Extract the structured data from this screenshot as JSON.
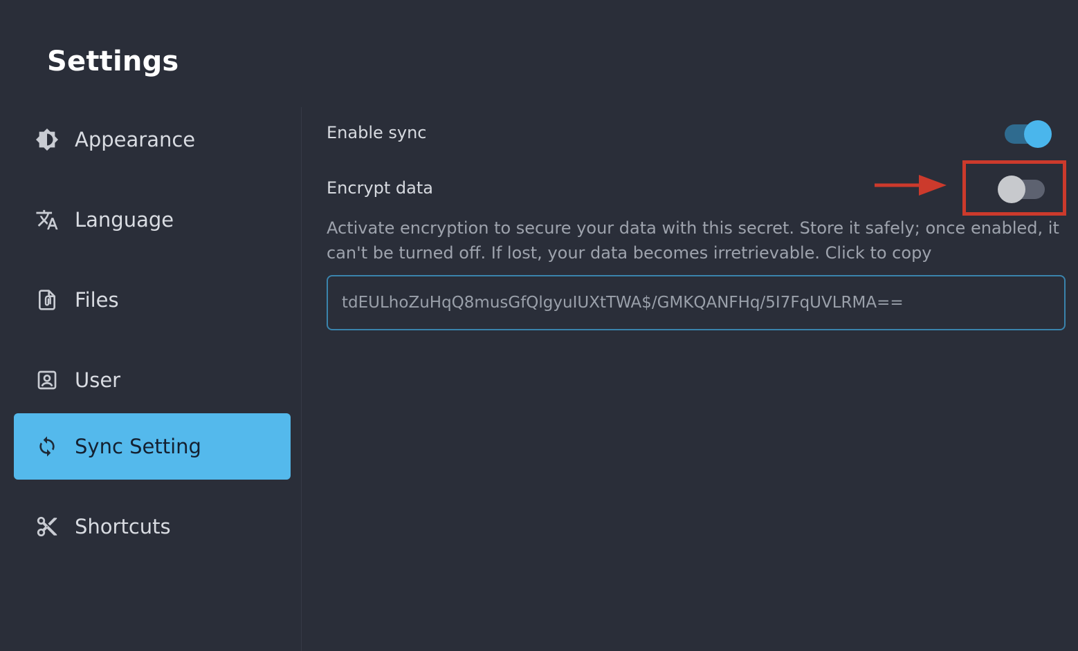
{
  "page_title": "Settings",
  "sidebar": {
    "items": [
      {
        "label": "Appearance",
        "icon": "appearance-icon",
        "active": false
      },
      {
        "label": "Language",
        "icon": "language-icon",
        "active": false
      },
      {
        "label": "Files",
        "icon": "files-icon",
        "active": false
      },
      {
        "label": "User",
        "icon": "user-icon",
        "active": false
      },
      {
        "label": "Sync Setting",
        "icon": "sync-icon",
        "active": true
      },
      {
        "label": "Shortcuts",
        "icon": "scissors-icon",
        "active": false
      }
    ]
  },
  "sync": {
    "enable_sync_label": "Enable sync",
    "enable_sync_on": true,
    "encrypt_label": "Encrypt data",
    "encrypt_on": false,
    "description": "Activate encryption to secure your data with this secret. Store it safely; once enabled, it can't be turned off. If lost, your data becomes irretrievable. Click to copy",
    "secret_value": "tdEULhoZuHqQ8musGfQlgyuIUXtTWA$/GMKQANFHq/5I7FqUVLRMA=="
  },
  "colors": {
    "background": "#2a2e39",
    "accent": "#54b9ec",
    "annotation_red": "#cc3a2c"
  }
}
